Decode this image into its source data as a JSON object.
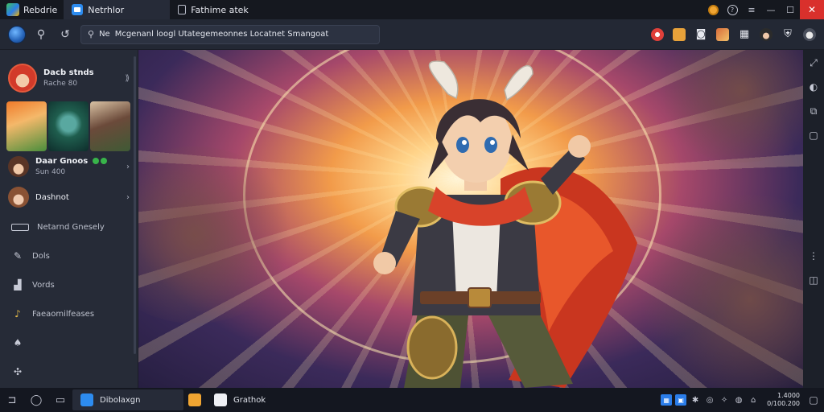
{
  "titlebar": {
    "app_name": "Rebdrie",
    "tabs": [
      {
        "label": "Netrhlor",
        "active": true
      },
      {
        "label": "Fathime atek",
        "active": false
      }
    ],
    "controls": {
      "coin_icon": "coin-icon",
      "help_icon": "help-icon",
      "minimize": "—",
      "maximize": "☐",
      "close": "✕"
    }
  },
  "toolbar": {
    "search_prefix": "Ne",
    "search_value": "Mcgenanl loogl Utategemeonnes Locatnet Smangoat",
    "icons": [
      "globe-icon",
      "gamepad-icon",
      "controller-icon",
      "search-icon",
      "pokeball-icon",
      "gift-icon",
      "camera-icon",
      "characters-icon",
      "grid-icon",
      "avatar-icon",
      "shield-icon",
      "account-icon"
    ]
  },
  "sidebar": {
    "profile": {
      "name": "Dacb stnds",
      "sub": "Rache 80"
    },
    "group": {
      "name": "Daar Gnoos",
      "sub": "Sun 400"
    },
    "friend": {
      "name": "Dashnot"
    },
    "items": [
      {
        "label": "Netarnd Gnesely",
        "icon": "keyboard-icon"
      },
      {
        "label": "Dols",
        "icon": "tools-icon"
      },
      {
        "label": "Vords",
        "icon": "store-icon"
      },
      {
        "label": "Faeaomilfeases",
        "icon": "music-icon"
      },
      {
        "label": "",
        "icon": "leaf-icon"
      },
      {
        "label": "",
        "icon": "settings-icon"
      }
    ]
  },
  "taskbar": {
    "apps": [
      {
        "label": "Dibolaxgn",
        "active": true
      },
      {
        "label": "",
        "active": false
      },
      {
        "label": "Grathok",
        "active": false
      }
    ],
    "clock": {
      "time": "1.4000",
      "date": "0/100.200"
    }
  },
  "colors": {
    "accent": "#2d8cf0",
    "close": "#d9302c",
    "sidebar": "#262b37",
    "titlebar": "#15181f"
  }
}
